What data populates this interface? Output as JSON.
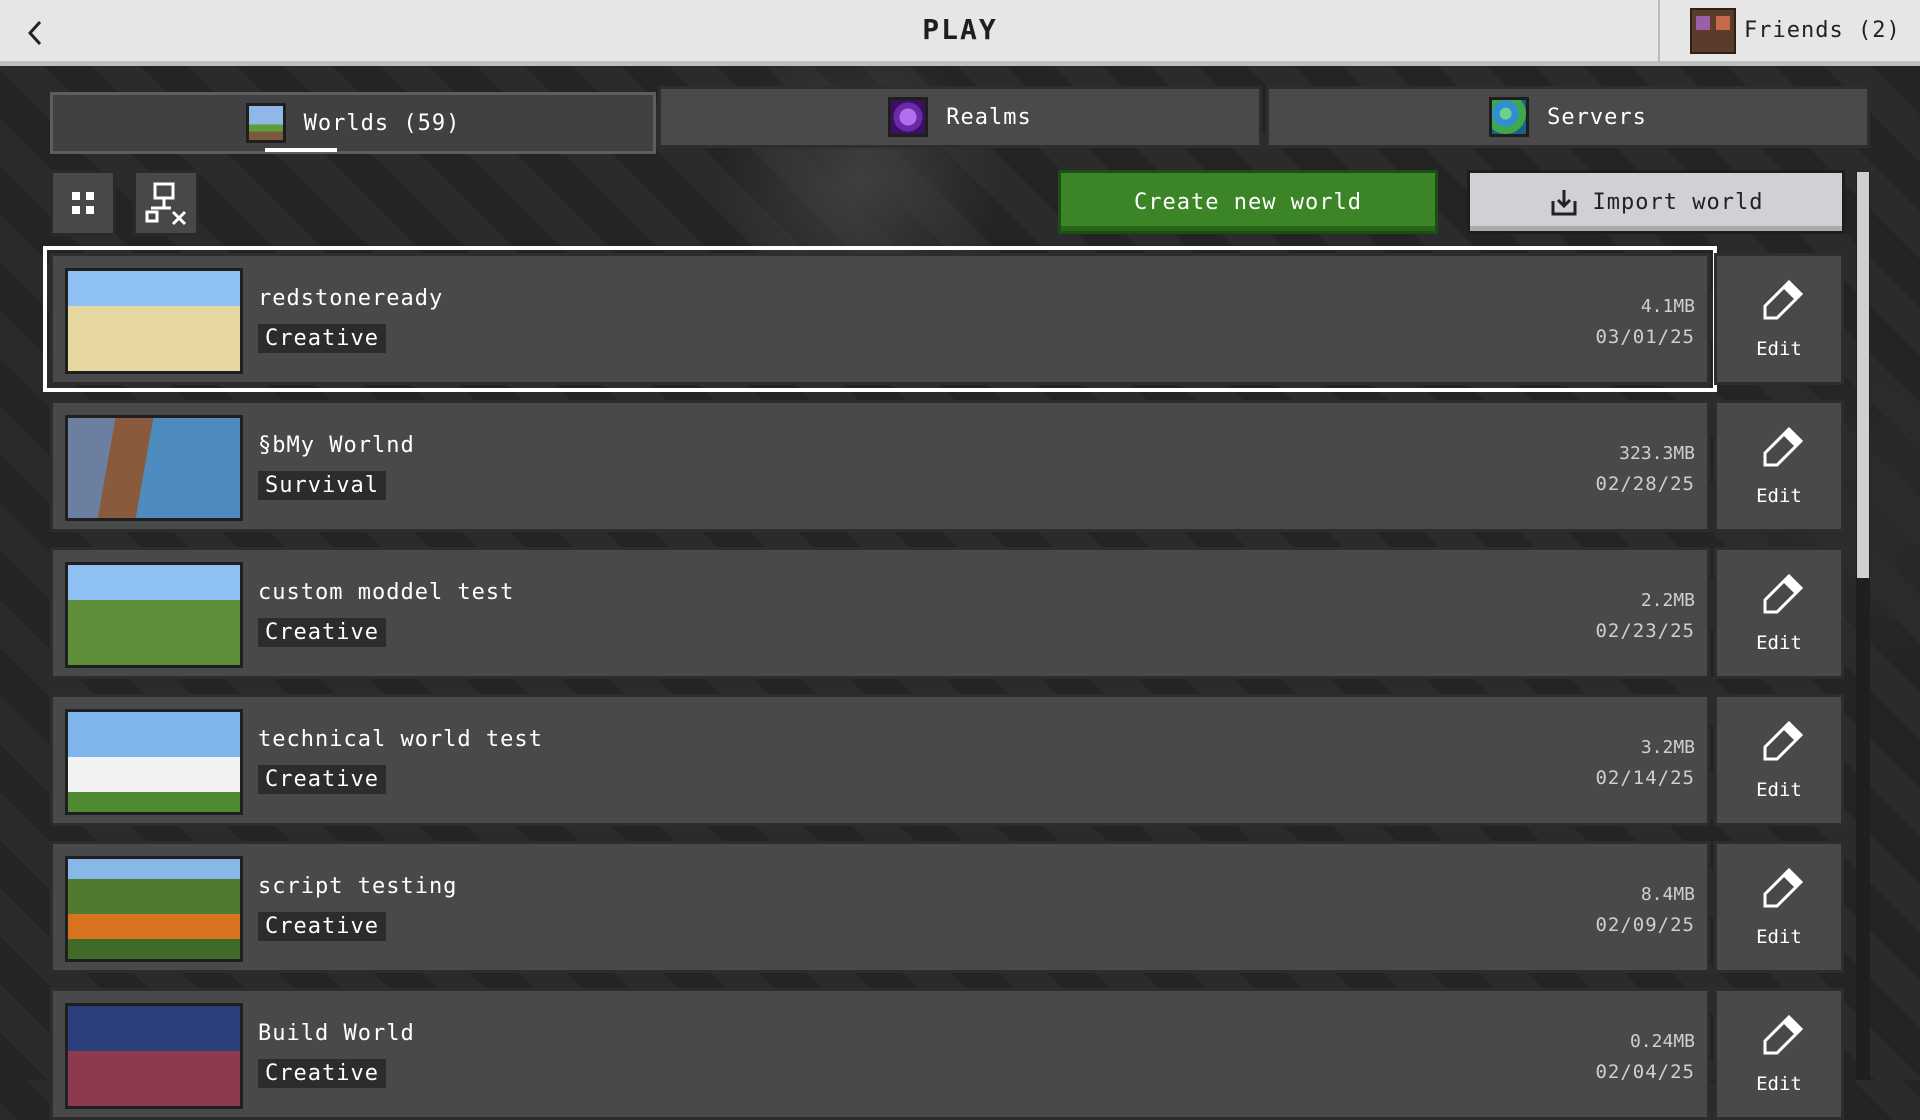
{
  "header": {
    "title": "PLAY",
    "friends_label": "Friends (2)"
  },
  "tabs": [
    {
      "label": "Worlds (59)",
      "icon": "worlds-icon",
      "active": true
    },
    {
      "label": "Realms",
      "icon": "realms-icon",
      "active": false
    },
    {
      "label": "Servers",
      "icon": "servers-icon",
      "active": false
    }
  ],
  "toolbar": {
    "create_label": "Create new world",
    "import_label": "Import world"
  },
  "worlds": [
    {
      "name": "redstoneready",
      "mode": "Creative",
      "size": "4.1MB",
      "date": "03/01/25",
      "edit_label": "Edit",
      "selected": true
    },
    {
      "name": "§bMy Worlnd",
      "mode": "Survival",
      "size": "323.3MB",
      "date": "02/28/25",
      "edit_label": "Edit"
    },
    {
      "name": "custom moddel test",
      "mode": "Creative",
      "size": "2.2MB",
      "date": "02/23/25",
      "edit_label": "Edit"
    },
    {
      "name": "technical world test",
      "mode": "Creative",
      "size": "3.2MB",
      "date": "02/14/25",
      "edit_label": "Edit"
    },
    {
      "name": "script testing",
      "mode": "Creative",
      "size": "8.4MB",
      "date": "02/09/25",
      "edit_label": "Edit"
    },
    {
      "name": "Build World",
      "mode": "Creative",
      "size": "0.24MB",
      "date": "02/04/25",
      "edit_label": "Edit"
    }
  ],
  "colors": {
    "accent_green": "#3c8527",
    "topbar": "#e6e6e6",
    "card": "#48494a"
  }
}
